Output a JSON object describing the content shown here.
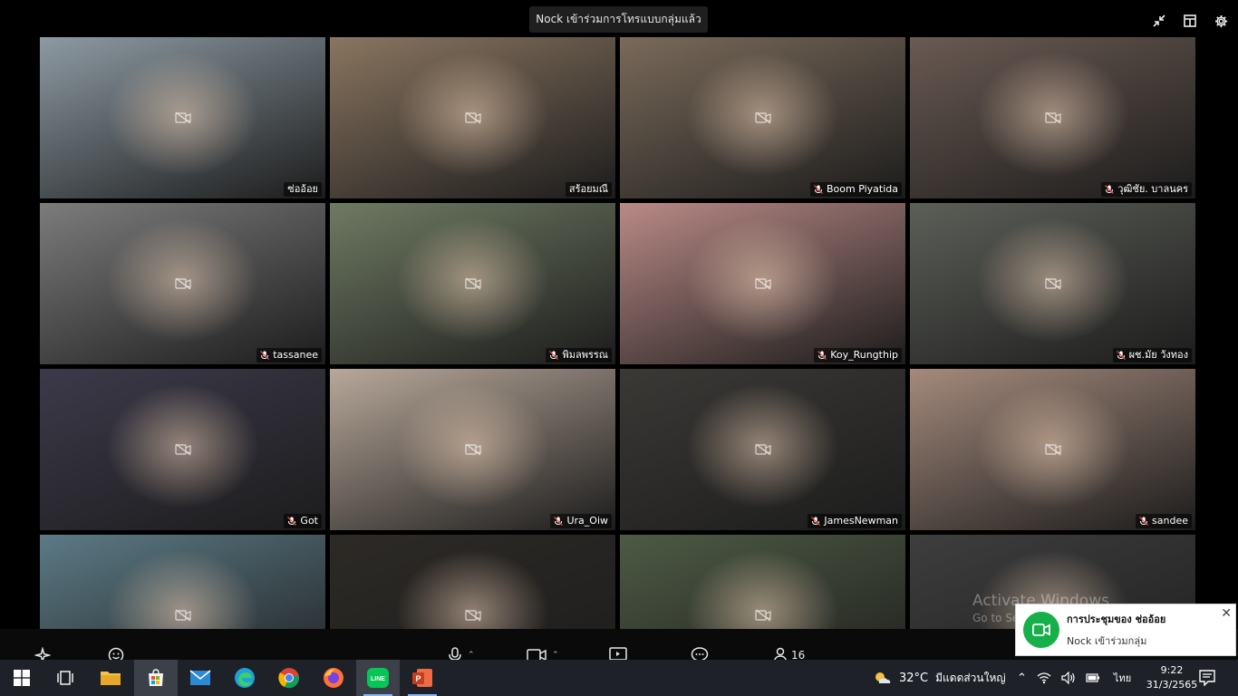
{
  "call": {
    "join_toast": "Nock เข้าร่วมการโทรแบบกลุ่มแล้ว",
    "participant_count": "16"
  },
  "participants": [
    {
      "name": "ซ่ออ้อย",
      "muted": false,
      "bg": "#8d9aa3"
    },
    {
      "name": "สร้อยมณี",
      "muted": false,
      "bg": "#8a7560"
    },
    {
      "name": "Boom Piyatida",
      "muted": true,
      "bg": "#7a6a5a"
    },
    {
      "name": "วุฒิชัย.  บาลนคร",
      "muted": true,
      "bg": "#6a5a52"
    },
    {
      "name": "tassanee",
      "muted": true,
      "bg": "#7c7c7c"
    },
    {
      "name": "พิมลพรรณ",
      "muted": true,
      "bg": "#6f7a62"
    },
    {
      "name": "Koy_Rungthip",
      "muted": true,
      "bg": "#b98a86"
    },
    {
      "name": "ผช.มัย วังทอง",
      "muted": true,
      "bg": "#5c5f58"
    },
    {
      "name": "Got",
      "muted": true,
      "bg": "#3c3a4a"
    },
    {
      "name": "Ura_Oiw",
      "muted": true,
      "bg": "#b8a89a"
    },
    {
      "name": "JamesNewman",
      "muted": true,
      "bg": "#3b3936"
    },
    {
      "name": "sandee",
      "muted": true,
      "bg": "#a48a7c"
    },
    {
      "name": "",
      "muted": false,
      "bg": "#5c7a86"
    },
    {
      "name": "",
      "muted": false,
      "bg": "#2d2a26"
    },
    {
      "name": "",
      "muted": false,
      "bg": "#4e5a44"
    },
    {
      "name": "",
      "muted": false,
      "bg": "#3e3e3e"
    }
  ],
  "watermark": {
    "line1": "Activate Windows",
    "line2": "Go to Settings to activate Windows."
  },
  "notification": {
    "title": "การประชุมของ ช่ออ้อย",
    "subtitle": "Nock เข้าร่วมกลุ่ม",
    "close": "✕"
  },
  "taskbar": {
    "weather_temp": "32°C",
    "weather_text": "มีแดดส่วนใหญ่",
    "language": "ไทย",
    "time": "9:22",
    "date": "31/3/2565"
  },
  "colors": {
    "background": "#000000",
    "accent_green": "#16b04a",
    "taskbar": "#1e2127"
  }
}
